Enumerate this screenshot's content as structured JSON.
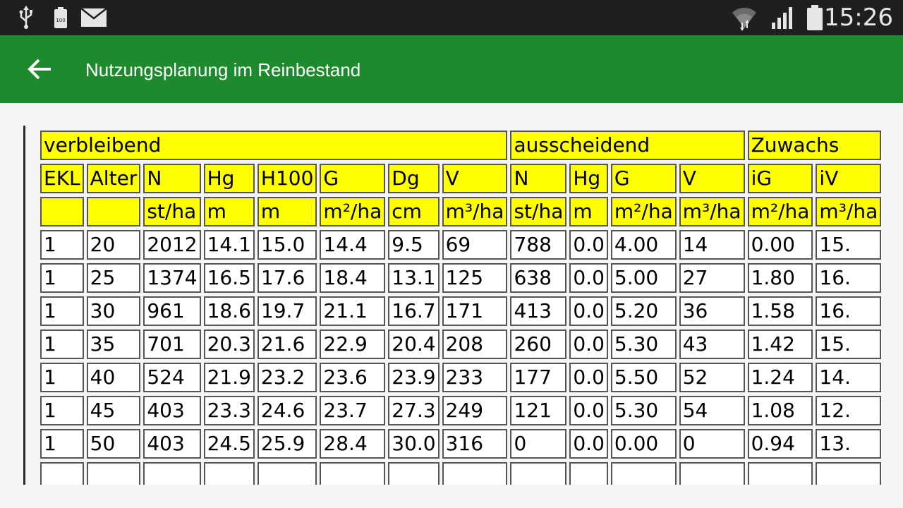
{
  "status_bar": {
    "time": "15:26",
    "left_icons": [
      "usb-icon",
      "battery-100-icon",
      "mail-icon"
    ],
    "right_icons": [
      "wifi-icon",
      "cell-signal-icon",
      "battery-icon"
    ],
    "battery_small_label": "100"
  },
  "app_bar": {
    "title": "Nutzungsplanung im Reinbestand",
    "back_icon": "arrow-left-icon",
    "background_color": "#1e8a2e"
  },
  "table": {
    "header_color": "#ffff00",
    "groups": [
      {
        "label": "verbleibend"
      },
      {
        "label": "ausscheidend"
      },
      {
        "label": "Zuwachs"
      }
    ],
    "columns": [
      "EKL",
      "Alter",
      "N",
      "Hg",
      "H100",
      "G",
      "Dg",
      "V",
      "N",
      "Hg",
      "G",
      "V",
      "iG",
      "iV"
    ],
    "units": [
      "",
      "",
      "st/ha",
      "m",
      "m",
      "m²/ha",
      "cm",
      "m³/ha",
      "st/ha",
      "m",
      "m²/ha",
      "m³/ha",
      "m²/ha",
      "m³/ha"
    ],
    "rows": [
      [
        "1",
        "20",
        "2012",
        "14.1",
        "15.0",
        "14.4",
        "9.5",
        "69",
        "788",
        "0.0",
        "4.00",
        "14",
        "0.00",
        "15."
      ],
      [
        "1",
        "25",
        "1374",
        "16.5",
        "17.6",
        "18.4",
        "13.1",
        "125",
        "638",
        "0.0",
        "5.00",
        "27",
        "1.80",
        "16."
      ],
      [
        "1",
        "30",
        "961",
        "18.6",
        "19.7",
        "21.1",
        "16.7",
        "171",
        "413",
        "0.0",
        "5.20",
        "36",
        "1.58",
        "16."
      ],
      [
        "1",
        "35",
        "701",
        "20.3",
        "21.6",
        "22.9",
        "20.4",
        "208",
        "260",
        "0.0",
        "5.30",
        "43",
        "1.42",
        "15."
      ],
      [
        "1",
        "40",
        "524",
        "21.9",
        "23.2",
        "23.6",
        "23.9",
        "233",
        "177",
        "0.0",
        "5.50",
        "52",
        "1.24",
        "14."
      ],
      [
        "1",
        "45",
        "403",
        "23.3",
        "24.6",
        "23.7",
        "27.3",
        "249",
        "121",
        "0.0",
        "5.30",
        "54",
        "1.08",
        "12."
      ],
      [
        "1",
        "50",
        "403",
        "24.5",
        "25.9",
        "28.4",
        "30.0",
        "316",
        "0",
        "0.0",
        "0.00",
        "0",
        "0.94",
        "13."
      ],
      [
        "",
        "",
        "",
        "",
        "",
        "",
        "",
        "",
        "",
        "",
        "",
        "",
        "",
        ""
      ]
    ]
  }
}
